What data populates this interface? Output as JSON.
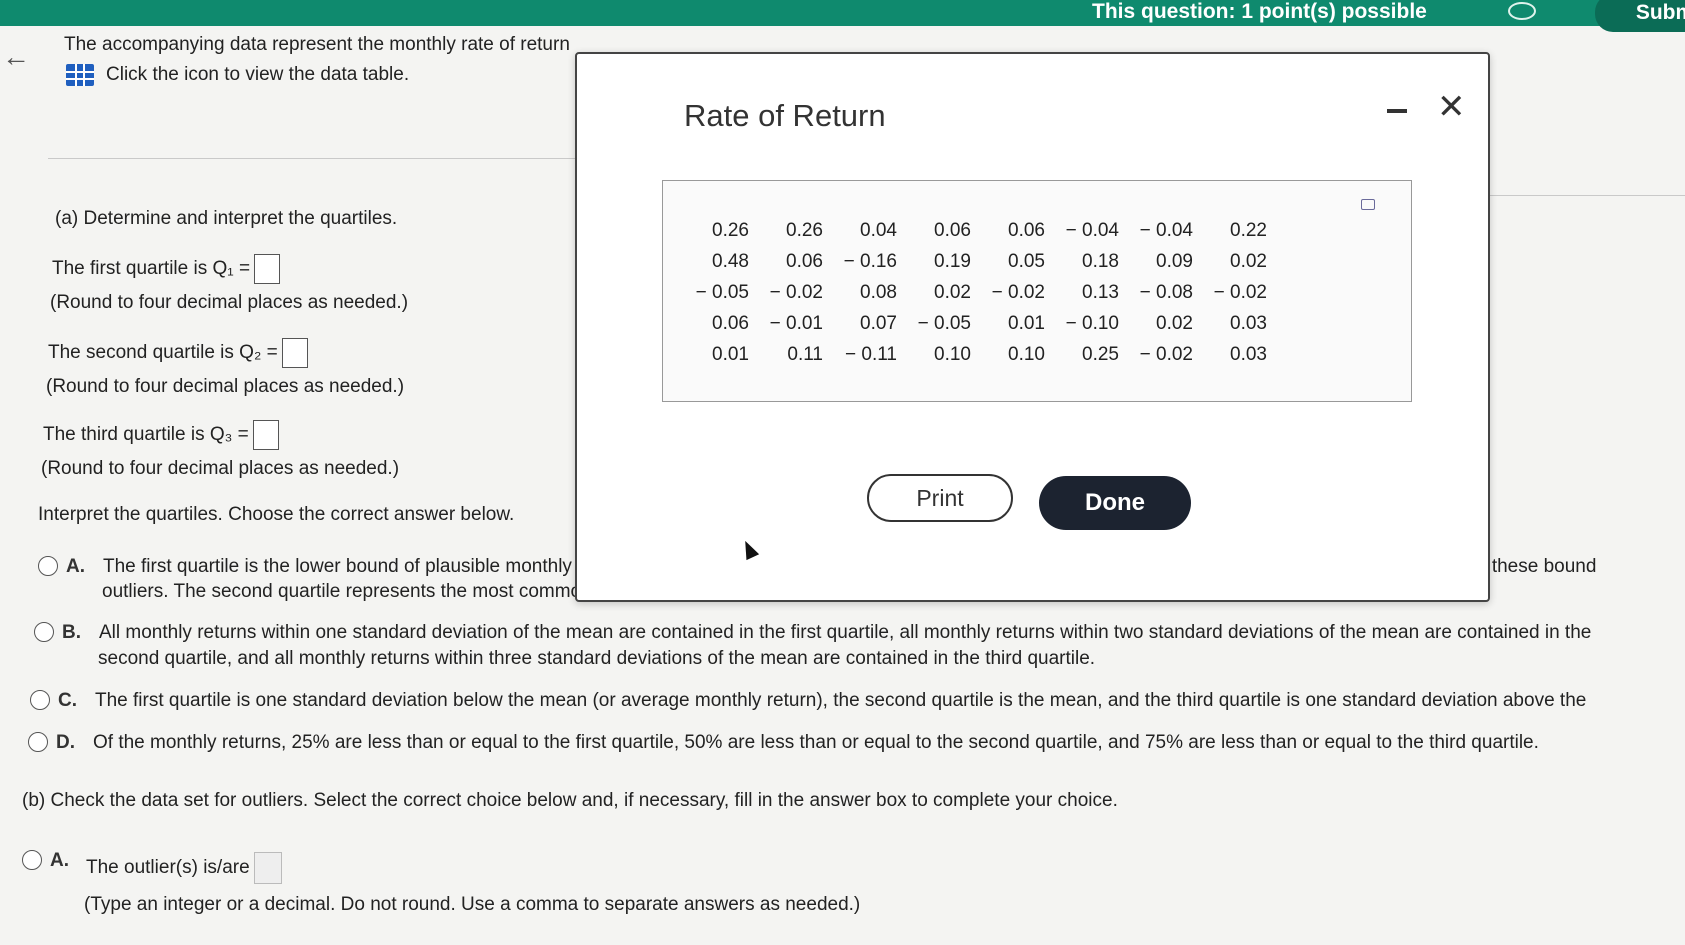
{
  "header": {
    "points": "This question: 1 point(s) possible",
    "submit_label": "Subm"
  },
  "question": {
    "intro": "The accompanying data represent the monthly rate of return",
    "click_text": "Click the icon to view the data table."
  },
  "part_a": {
    "heading": "(a) Determine and interpret the quartiles.",
    "q1_label": "The first quartile is Q₁ =",
    "q2_label": "The second quartile is Q₂ =",
    "q3_label": "The third quartile is Q₃ =",
    "round_note": "(Round to four decimal places as needed.)",
    "interpret_prompt": "Interpret the quartiles. Choose the correct answer below.",
    "options": [
      {
        "letter": "A.",
        "lines": [
          "The first quartile is the lower bound of plausible monthly returns, and the third quartile is the upper bound of plausible monthly returns. Any monthly returns outside of these bound",
          "outliers. The second quartile represents the most common monthly return."
        ]
      },
      {
        "letter": "B.",
        "lines": [
          "All monthly returns within one standard deviation of the mean are contained in the first quartile, all monthly returns within two standard deviations of the mean are contained in the",
          "second quartile, and all monthly returns within three standard deviations of the mean are contained in the third quartile."
        ]
      },
      {
        "letter": "C.",
        "lines": [
          "The first quartile is one standard deviation below the mean (or average monthly return), the second quartile is the mean, and the third quartile is one standard deviation above the"
        ]
      },
      {
        "letter": "D.",
        "lines": [
          "Of the monthly returns, 25% are less than or equal to the first quartile, 50% are less than or equal to the second quartile, and 75% are less than or equal to the third quartile."
        ]
      }
    ]
  },
  "part_b": {
    "heading": "(b) Check the data set for outliers. Select the correct choice below and, if necessary, fill in the answer box to complete your choice.",
    "option_a_letter": "A.",
    "option_a_text": "The outlier(s) is/are",
    "type_note": "(Type an integer or a decimal. Do not round. Use a comma to separate answers as needed.)"
  },
  "modal": {
    "title": "Rate of Return",
    "print_label": "Print",
    "done_label": "Done",
    "rows": [
      [
        "0.26",
        "0.26",
        "0.04",
        "0.06",
        "0.06",
        "− 0.04",
        "− 0.04",
        "0.22"
      ],
      [
        "0.48",
        "0.06",
        "− 0.16",
        "0.19",
        "0.05",
        "0.18",
        "0.09",
        "0.02"
      ],
      [
        "− 0.05",
        "− 0.02",
        "0.08",
        "0.02",
        "− 0.02",
        "0.13",
        "− 0.08",
        "− 0.02"
      ],
      [
        "0.06",
        "− 0.01",
        "0.07",
        "− 0.05",
        "0.01",
        "− 0.10",
        "0.02",
        "0.03"
      ],
      [
        "0.01",
        "0.11",
        "− 0.11",
        "0.10",
        "0.10",
        "0.25",
        "− 0.02",
        "0.03"
      ]
    ]
  }
}
